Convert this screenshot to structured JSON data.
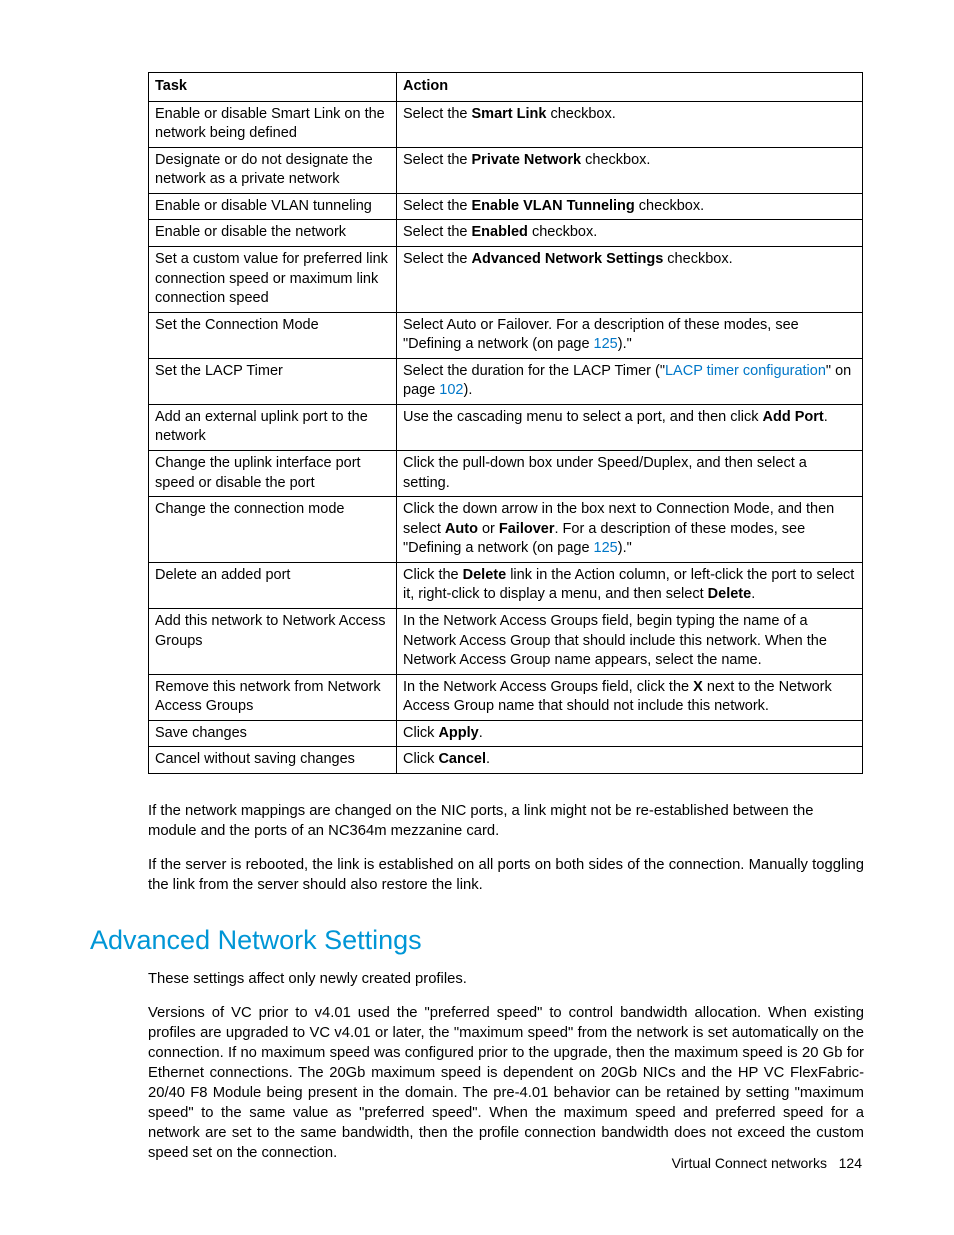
{
  "table": {
    "headers": {
      "task": "Task",
      "action": "Action"
    },
    "rows": [
      {
        "task": "Enable or disable Smart Link on the network being defined",
        "action": {
          "pre": "Select the ",
          "bold": "Smart Link",
          "post": " checkbox."
        }
      },
      {
        "task": "Designate or do not designate the network as a private network",
        "action": {
          "pre": "Select the ",
          "bold": "Private Network",
          "post": " checkbox."
        }
      },
      {
        "task": "Enable or disable VLAN tunneling",
        "action": {
          "pre": "Select the ",
          "bold": "Enable VLAN Tunneling",
          "post": " checkbox."
        }
      },
      {
        "task": "Enable or disable the network",
        "action": {
          "pre": "Select the ",
          "bold": "Enabled",
          "post": " checkbox."
        }
      },
      {
        "task": "Set a custom value for preferred link connection speed or maximum link connection speed",
        "action": {
          "pre": "Select the ",
          "bold": "Advanced Network Settings",
          "post": " checkbox."
        }
      },
      {
        "task": "Set the Connection Mode",
        "action": {
          "pre": "Select Auto or Failover. For a description of these modes, see \"Defining a network (on page ",
          "link": "125",
          "post": ").\""
        }
      },
      {
        "task": "Set the LACP Timer",
        "action": {
          "pre": "Select the duration for the LACP Timer (\"",
          "linktext": "LACP timer configuration",
          "mid": "\" on page ",
          "link": "102",
          "post": ")."
        }
      },
      {
        "task": "Add an external uplink port to the network",
        "action": {
          "pre": "Use the cascading menu to select a port, and then click ",
          "bold": "Add Port",
          "post": "."
        }
      },
      {
        "task": "Change the uplink interface port speed or disable the port",
        "action": {
          "text": "Click the pull-down box under Speed/Duplex, and then select a setting."
        }
      },
      {
        "task": "Change the connection mode",
        "action": {
          "pre": "Click the down arrow in the box next to Connection Mode, and then select ",
          "bold": "Auto",
          "mid": " or ",
          "bold2": "Failover",
          "post1": ". For a description of these modes, see \"Defining a network (on page ",
          "link": "125",
          "post2": ").\""
        }
      },
      {
        "task": "Delete an added port",
        "action": {
          "pre": "Click the ",
          "bold": "Delete",
          "mid": " link in the Action column, or left-click the port to select it, right-click to display a menu, and then select ",
          "bold2": "Delete",
          "post": "."
        }
      },
      {
        "task": "Add this network to Network Access Groups",
        "action": {
          "text": "In the Network Access Groups field, begin typing the name of a Network Access Group that should include this network. When the Network Access Group name appears, select the name."
        }
      },
      {
        "task": "Remove this network from Network Access Groups",
        "action": {
          "pre": "In the Network Access Groups field, click the ",
          "bold": "X",
          "post": " next to the Network Access Group name that should not include this network."
        }
      },
      {
        "task": "Save changes",
        "action": {
          "pre": "Click ",
          "bold": "Apply",
          "post": "."
        }
      },
      {
        "task": "Cancel without saving changes",
        "action": {
          "pre": "Click ",
          "bold": "Cancel",
          "post": "."
        }
      }
    ]
  },
  "para1": "If the network mappings are changed on the NIC ports, a link might not be re-established between the module and the ports of an NC364m mezzanine card.",
  "para2": "If the server is rebooted, the link is established on all ports on both sides of the connection. Manually toggling the link from the server should also restore the link.",
  "section_heading": "Advanced Network Settings",
  "para3": "These settings affect only newly created profiles.",
  "para4": "Versions of VC prior to v4.01 used the \"preferred speed\" to control bandwidth allocation. When existing profiles are upgraded to VC v4.01 or later, the \"maximum speed\" from the network is set automatically on the connection. If no maximum speed was configured prior to the upgrade, then the maximum speed is 20 Gb for Ethernet connections. The 20Gb maximum speed is dependent on 20Gb NICs and the HP VC FlexFabric-20/40 F8 Module being present in the domain. The pre-4.01 behavior can be retained by setting \"maximum speed\" to the same value as \"preferred speed\". When the maximum speed and preferred speed for a network are set to the same bandwidth, then the profile connection bandwidth does not exceed the custom speed set on the connection.",
  "footer": {
    "label": "Virtual Connect networks",
    "page": "124"
  }
}
